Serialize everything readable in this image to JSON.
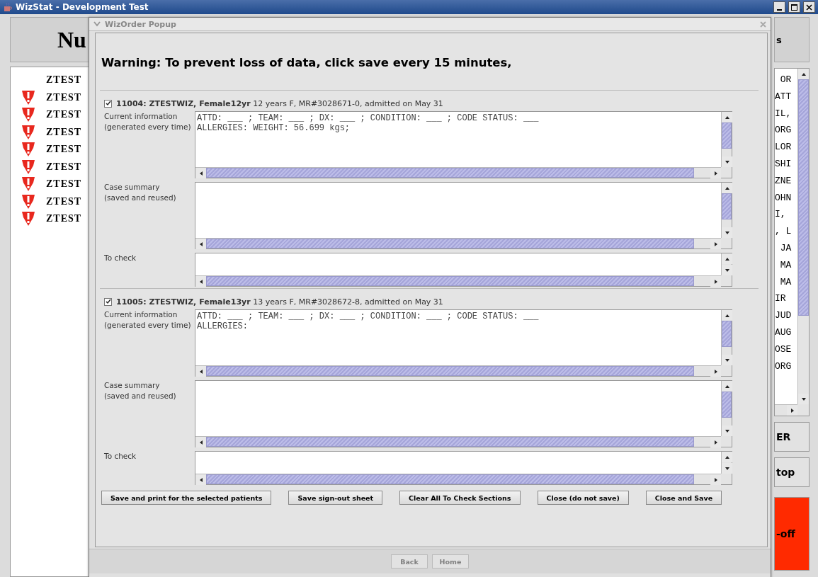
{
  "window": {
    "title": "WizStat - Development Test"
  },
  "background": {
    "heading": "Nu",
    "right_heading": "s",
    "patients": [
      {
        "name": "ZTEST",
        "alert": false
      },
      {
        "name": "ZTEST",
        "alert": true
      },
      {
        "name": "ZTEST",
        "alert": true
      },
      {
        "name": "ZTEST",
        "alert": true
      },
      {
        "name": "ZTEST",
        "alert": true
      },
      {
        "name": "ZTEST",
        "alert": true
      },
      {
        "name": "ZTEST",
        "alert": true
      },
      {
        "name": "ZTEST",
        "alert": true
      },
      {
        "name": "ZTEST",
        "alert": true
      }
    ],
    "right_rows": [
      " OR",
      "ATT",
      "IL,",
      "ORG",
      "LOR",
      "SHI",
      "ZNE",
      "OHN",
      "I,",
      ", L",
      " JA",
      " MA",
      " MA",
      "IR",
      "JUD",
      "AUG",
      "OSE",
      "ORG"
    ],
    "buttons": [
      {
        "label": "ER",
        "kind": "plain"
      },
      {
        "label": "top",
        "kind": "plain"
      },
      {
        "label": "-off",
        "kind": "alert"
      }
    ]
  },
  "popup": {
    "title": "WizOrder Popup",
    "warning": "Warning: To prevent loss of data, click save every 15 minutes,",
    "patients": [
      {
        "checked": true,
        "title": "11004: ZTESTWIZ, Female12yr",
        "details": "12 years F, MR#3028671-0, admitted on May 31",
        "fields": [
          {
            "kind": "large",
            "label": "Current information\n(generated every time)",
            "value": "ATTD: ___ ; TEAM: ___ ; DX: ___ ; CONDITION: ___ ; CODE STATUS: ___\nALLERGIES: WEIGHT: 56.699 kgs;"
          },
          {
            "kind": "large",
            "label": "Case summary\n(saved and reused)"
          },
          {
            "kind": "small",
            "label": "To check"
          }
        ]
      },
      {
        "checked": true,
        "title": "11005: ZTESTWIZ, Female13yr",
        "details": "13 years F, MR#3028672-8, admitted on May 31",
        "fields": [
          {
            "kind": "large",
            "label": "Current information\n(generated every time)",
            "value": "ATTD: ___ ; TEAM: ___ ; DX: ___ ; CONDITION: ___ ; CODE STATUS: ___\nALLERGIES:"
          },
          {
            "kind": "large",
            "label": "Case summary\n(saved and reused)"
          },
          {
            "kind": "small",
            "label": "To check"
          }
        ]
      }
    ],
    "buttons": [
      "Save and print for the selected patients",
      "Save sign-out sheet",
      "Clear All To Check Sections",
      "Close (do not save)",
      "Close and Save"
    ],
    "nav_buttons": [
      {
        "label": "Back",
        "disabled": true
      },
      {
        "label": "Home",
        "disabled": true
      }
    ]
  }
}
